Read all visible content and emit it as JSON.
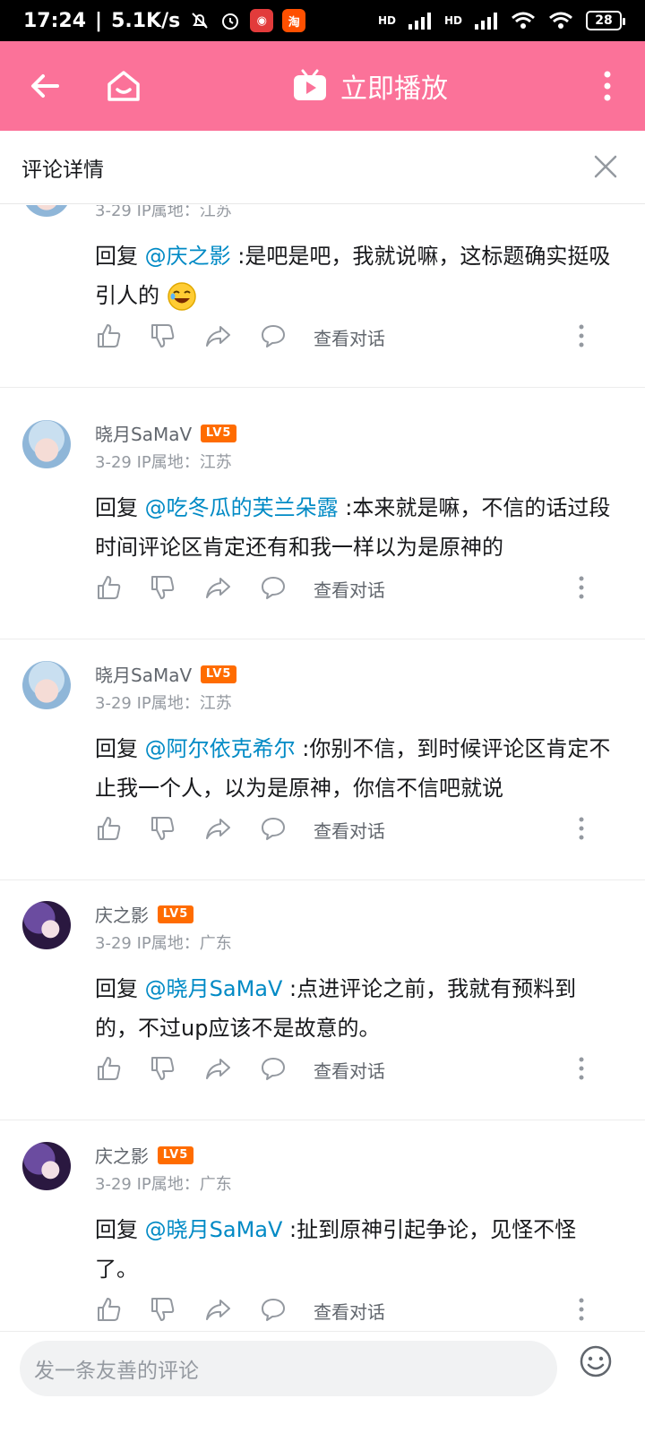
{
  "status_bar": {
    "time": "17:24",
    "speed": "5.1K/s",
    "network_a": "HD",
    "network_b": "HD",
    "battery": "28"
  },
  "top_bar": {
    "play_label": "立即播放"
  },
  "detail_header": {
    "title": "评论详情"
  },
  "comments": [
    {
      "username": "",
      "level": "",
      "date": "3-29",
      "ip": "IP属地：江苏",
      "reply_prefix": "回复 ",
      "mention": "@庆之影",
      "text": " :是吧是吧，我就说嘛，这标题确实挺吸引人的",
      "view_conversation": "查看对话"
    },
    {
      "username": "晓月SaMaV",
      "level": "LV5",
      "date": "3-29",
      "ip": "IP属地：江苏",
      "reply_prefix": "回复 ",
      "mention": "@吃冬瓜的芙兰朵露",
      "text": " :本来就是嘛，不信的话过段时间评论区肯定还有和我一样以为是原神的",
      "view_conversation": "查看对话"
    },
    {
      "username": "晓月SaMaV",
      "level": "LV5",
      "date": "3-29",
      "ip": "IP属地：江苏",
      "reply_prefix": "回复 ",
      "mention": "@阿尔依克希尔",
      "text": " :你别不信，到时候评论区肯定不止我一个人，以为是原神，你信不信吧就说",
      "view_conversation": "查看对话"
    },
    {
      "username": "庆之影",
      "level": "LV5",
      "date": "3-29",
      "ip": "IP属地：广东",
      "reply_prefix": "回复 ",
      "mention": "@晓月SaMaV",
      "text": " :点进评论之前，我就有预料到的，不过up应该不是故意的。",
      "view_conversation": "查看对话"
    },
    {
      "username": "庆之影",
      "level": "LV5",
      "date": "3-29",
      "ip": "IP属地：广东",
      "reply_prefix": "回复 ",
      "mention": "@晓月SaMaV",
      "text": " :扯到原神引起争论，见怪不怪了。",
      "view_conversation": "查看对话"
    }
  ],
  "bottom_bar": {
    "placeholder": "发一条友善的评论"
  },
  "colors": {
    "brand_pink": "#fb7299",
    "mention_blue": "#008ac5",
    "level_orange": "#ff6c00"
  }
}
